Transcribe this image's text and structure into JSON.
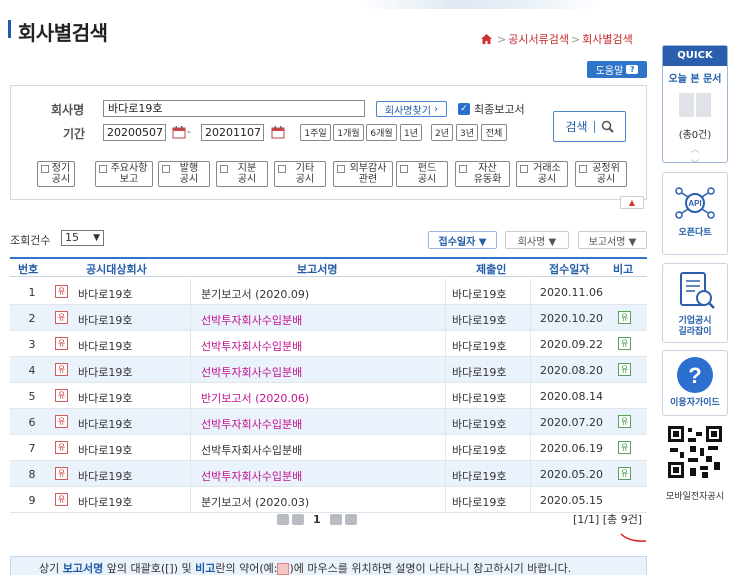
{
  "page": {
    "title": "회사별검색",
    "breadcrumb": {
      "item1": "공시서류검색",
      "item2": "회사별검색"
    },
    "help_label": "도움말"
  },
  "search": {
    "company_label": "회사명",
    "company_value": "바다로19호",
    "find_company_label": "회사명찾기",
    "final_report_label": "최종보고서",
    "period_label": "기간",
    "date_from": "20200507",
    "date_to": "20201107",
    "period_buttons": [
      "1주일",
      "1개월",
      "6개월",
      "1년",
      "2년",
      "3년",
      "전체"
    ],
    "search_label": "검색",
    "types": [
      "정기\n공시",
      "주요사항\n보고",
      "발행\n공시",
      "지분\n공시",
      "기타\n공시",
      "외부감사\n관련",
      "펀드\n공시",
      "자산\n유동화",
      "거래소\n공시",
      "공정위\n공시"
    ]
  },
  "results": {
    "count_label": "조회건수",
    "count_value": "15",
    "sort_buttons": [
      "접수일자 ▼",
      "회사명 ▼",
      "보고서명 ▼"
    ],
    "columns": [
      "번호",
      "공시대상회사",
      "보고서명",
      "제출인",
      "접수일자",
      "비고"
    ],
    "rows": [
      {
        "no": "1",
        "badge": "유",
        "company": "바다로19호",
        "report": "분기보고서 (2020.09)",
        "submitter": "바다로19호",
        "date": "2020.11.06",
        "note": ""
      },
      {
        "no": "2",
        "badge": "유",
        "company": "바다로19호",
        "report": "선박투자회사수입분배",
        "submitter": "바다로19호",
        "date": "2020.10.20",
        "note": "유"
      },
      {
        "no": "3",
        "badge": "유",
        "company": "바다로19호",
        "report": "선박투자회사수입분배",
        "submitter": "바다로19호",
        "date": "2020.09.22",
        "note": "유"
      },
      {
        "no": "4",
        "badge": "유",
        "company": "바다로19호",
        "report": "선박투자회사수입분배",
        "submitter": "바다로19호",
        "date": "2020.08.20",
        "note": "유"
      },
      {
        "no": "5",
        "badge": "유",
        "company": "바다로19호",
        "report": "반기보고서 (2020.06)",
        "submitter": "바다로19호",
        "date": "2020.08.14",
        "note": ""
      },
      {
        "no": "6",
        "badge": "유",
        "company": "바다로19호",
        "report": "선박투자회사수입분배",
        "submitter": "바다로19호",
        "date": "2020.07.20",
        "note": "유"
      },
      {
        "no": "7",
        "badge": "유",
        "company": "바다로19호",
        "report": "선박투자회사수입분배",
        "submitter": "바다로19호",
        "date": "2020.06.19",
        "note": "유"
      },
      {
        "no": "8",
        "badge": "유",
        "company": "바다로19호",
        "report": "선박투자회사수입분배",
        "submitter": "바다로19호",
        "date": "2020.05.20",
        "note": "유"
      },
      {
        "no": "9",
        "badge": "유",
        "company": "바다로19호",
        "report": "분기보고서 (2020.03)",
        "submitter": "바다로19호",
        "date": "2020.05.15",
        "note": ""
      }
    ],
    "current_page": "1",
    "total_info": "[1/1] [총 9건]"
  },
  "notice": {
    "part1": "상기 ",
    "part2": "보고서명",
    "part3": " 앞의 대괄호([]) 및 ",
    "part4": "비고",
    "part5": "란의 약어(예:",
    "part6": ")에 마우스를 위치하면 설명이 나타나니 참고하시기 바랍니다."
  },
  "sidebar": {
    "quick_label": "QUICK",
    "recent_docs_label": "오늘 본 문서",
    "recent_count": "(총0건)",
    "opendart_label": "오픈다트",
    "disclosure_guide_label": "기업공시\n길라잡이",
    "user_guide_label": "이용자가이드",
    "mobile_label": "모바일전자공시"
  },
  "colors": {
    "accent": "#2f75c9",
    "pink_report": "#c2138f",
    "row_alt": "#eaf2fb"
  }
}
